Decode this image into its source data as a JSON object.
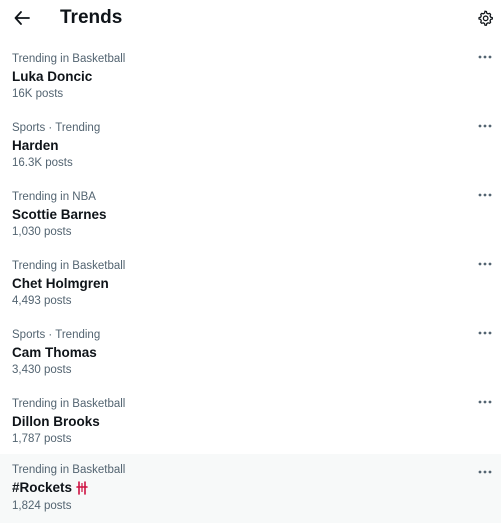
{
  "header": {
    "title": "Trends",
    "back_icon": "arrow-left-icon",
    "settings_icon": "gear-icon"
  },
  "trends": [
    {
      "context": "Trending in Basketball",
      "name": "Luka Doncic",
      "count": "16K posts"
    },
    {
      "context": "Sports · Trending",
      "name": "Harden",
      "count": "16.3K posts"
    },
    {
      "context": "Trending in NBA",
      "name": "Scottie Barnes",
      "count": "1,030 posts"
    },
    {
      "context": "Trending in Basketball",
      "name": "Chet Holmgren",
      "count": "4,493 posts"
    },
    {
      "context": "Sports · Trending",
      "name": "Cam Thomas",
      "count": "3,430 posts"
    },
    {
      "context": "Trending in Basketball",
      "name": "Dillon Brooks",
      "count": "1,787 posts"
    },
    {
      "context": "Trending in Basketball",
      "name": "#Rockets",
      "count": "1,824 posts",
      "hashflag_icon": "rockets-logo-icon"
    }
  ],
  "more_icon": "more-dots-icon",
  "colors": {
    "text_primary": "#0f1419",
    "text_secondary": "#536471",
    "hover_bg": "#f7f9f9",
    "rockets_red": "#ce1141"
  }
}
